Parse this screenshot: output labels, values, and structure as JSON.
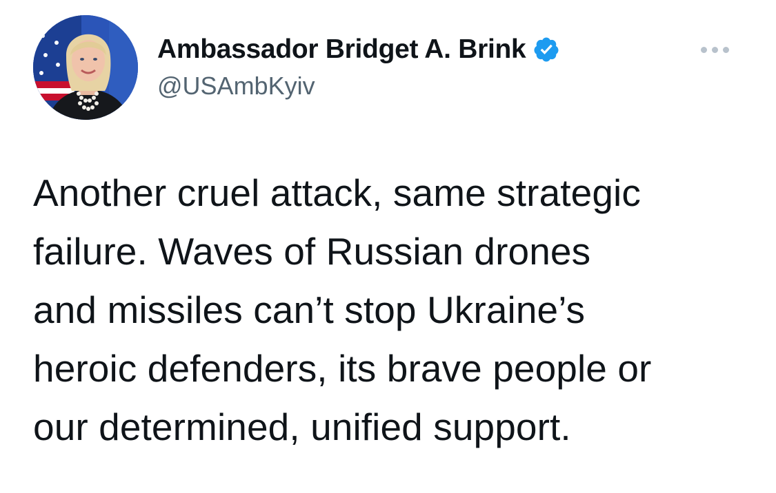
{
  "author": {
    "display_name": "Ambassador Bridget A. Brink",
    "handle": "@USAmbKyiv",
    "verified": true,
    "avatar_icon": "profile-photo",
    "verified_icon": "verified-badge-icon",
    "verified_color": "#1d9bf0"
  },
  "menu": {
    "more_icon": "more-options-icon"
  },
  "tweet": {
    "lines": [
      "Another cruel attack, same strategic",
      "failure. Waves of Russian drones",
      "and missiles can’t stop Ukraine’s",
      "heroic defenders, its brave people or",
      "our determined, unified support."
    ]
  },
  "colors": {
    "text": "#0f1419",
    "secondary_text": "#536471",
    "dots": "#b8c2cc"
  }
}
